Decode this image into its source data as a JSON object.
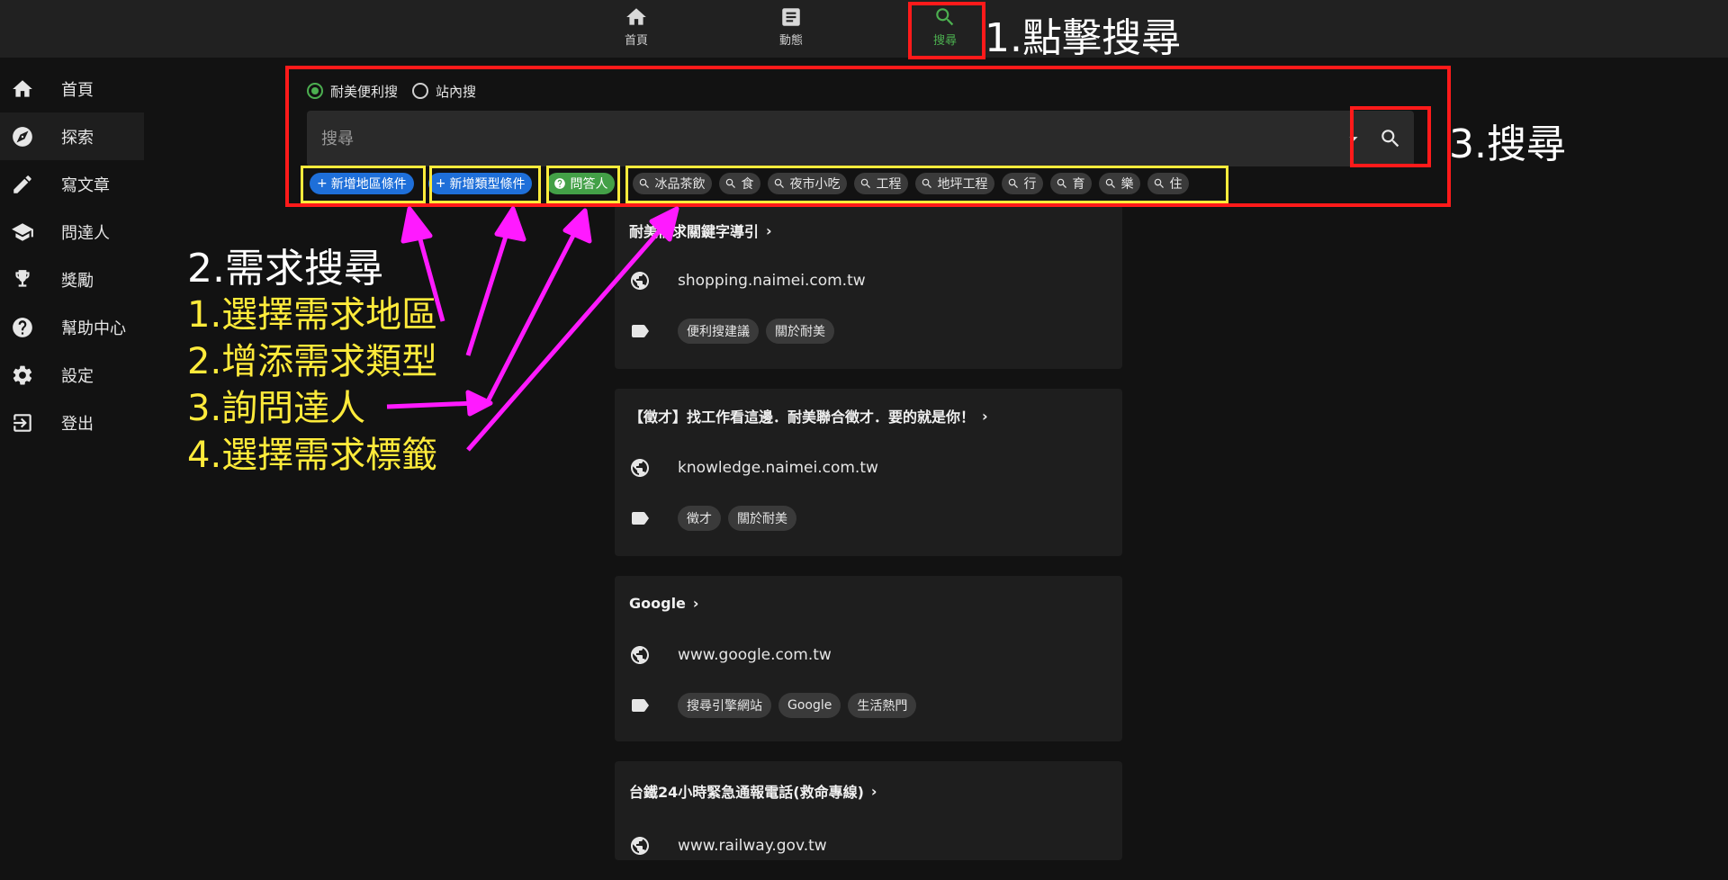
{
  "topnav": {
    "items": [
      {
        "label": "首頁",
        "icon": "home-icon"
      },
      {
        "label": "動態",
        "icon": "feed-icon"
      },
      {
        "label": "搜尋",
        "icon": "search-icon"
      }
    ]
  },
  "sidebar": {
    "items": [
      {
        "label": "首頁",
        "icon": "home-icon"
      },
      {
        "label": "探索",
        "icon": "compass-icon"
      },
      {
        "label": "寫文章",
        "icon": "pencil-icon"
      },
      {
        "label": "問達人",
        "icon": "graduation-cap-icon"
      },
      {
        "label": "獎勵",
        "icon": "trophy-icon"
      },
      {
        "label": "幫助中心",
        "icon": "help-icon"
      },
      {
        "label": "設定",
        "icon": "gear-icon"
      },
      {
        "label": "登出",
        "icon": "logout-icon"
      }
    ]
  },
  "search": {
    "options": [
      "耐美便利搜",
      "站內搜"
    ],
    "selected": "耐美便利搜",
    "placeholder": "搜尋",
    "condition_buttons": [
      "新增地區條件",
      "新增類型條件"
    ],
    "ask_button": "問答人",
    "tags": [
      "冰品茶飲",
      "食",
      "夜市小吃",
      "工程",
      "地坪工程",
      "行",
      "育",
      "樂",
      "住"
    ]
  },
  "results": [
    {
      "title": "耐美需求關鍵字導引",
      "url": "shopping.naimei.com.tw",
      "tags": [
        "便利搜建議",
        "關於耐美"
      ]
    },
    {
      "title": "【徵才】找工作看這邊．耐美聯合徵才．要的就是你！",
      "url": "knowledge.naimei.com.tw",
      "tags": [
        "徵才",
        "關於耐美"
      ]
    },
    {
      "title": "Google",
      "url": "www.google.com.tw",
      "tags": [
        "搜尋引擎網站",
        "Google",
        "生活熱門"
      ]
    },
    {
      "title": "台鐵24小時緊急通報電話(救命專線)",
      "url": "www.railway.gov.tw",
      "tags": []
    }
  ],
  "annotations": {
    "step1": "1.點擊搜尋",
    "step2_title": "2.需求搜尋",
    "step2_items": [
      "1.選擇需求地區",
      "2.增添需求類型",
      "3.詢問達人",
      "4.選擇需求標籤"
    ],
    "step3": "3.搜尋",
    "colors": {
      "box_red": "#ff1a1a",
      "box_yellow": "#ffeb3b",
      "arrow": "#ff1aff",
      "accent_green": "#4caf50",
      "chip_blue": "#1e6fd9"
    }
  }
}
